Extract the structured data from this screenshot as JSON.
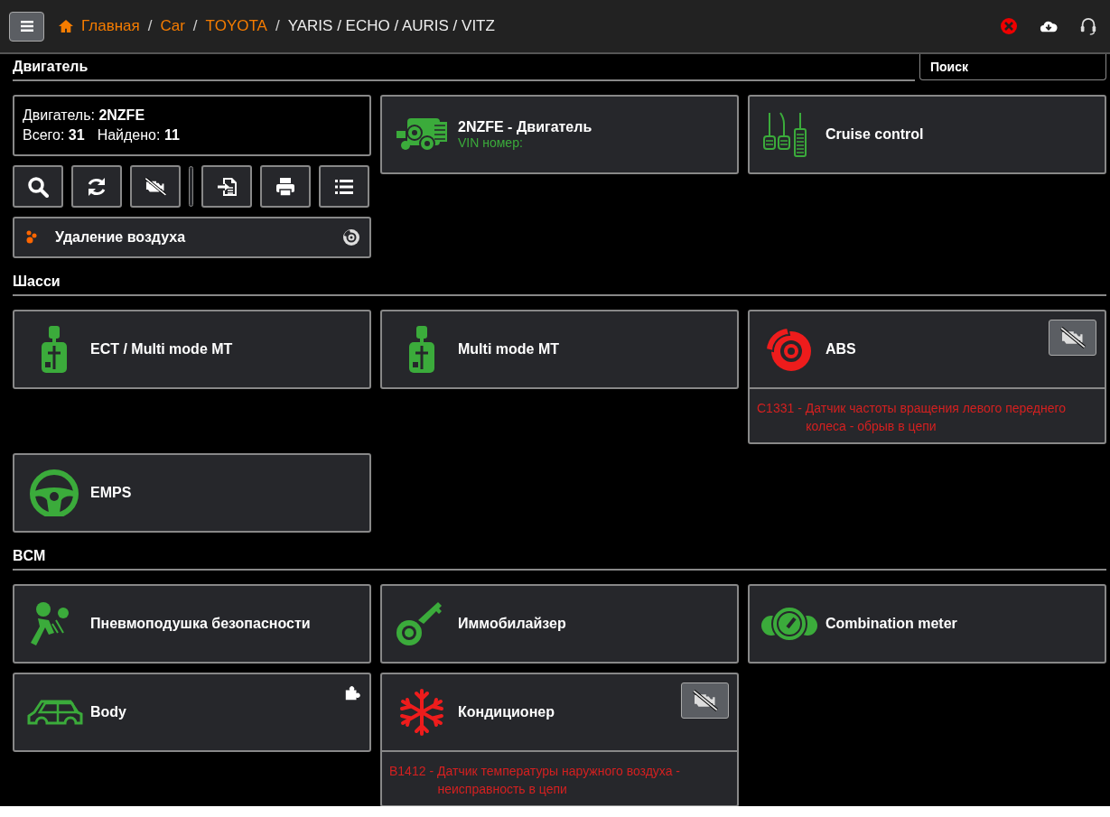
{
  "topbar": {
    "breadcrumbs": [
      {
        "label": "Главная",
        "link": true
      },
      {
        "label": "Car",
        "link": true
      },
      {
        "label": "TOYOTA",
        "link": true
      },
      {
        "label": "YARIS / ECHO / AURIS / VITZ",
        "link": false
      }
    ],
    "separators": [
      "/",
      "/",
      "/"
    ]
  },
  "search": {
    "placeholder": "Поиск"
  },
  "sections": [
    {
      "title": "Двигатель",
      "summary": {
        "lines": [
          [
            "Двигатель: **2NZFE**"
          ],
          [
            "Всего: **31**",
            "Найдено: **11**"
          ]
        ]
      },
      "toolbar": [
        {
          "kind": "search"
        },
        {
          "kind": "refresh"
        },
        {
          "kind": "engine-off"
        },
        {
          "kind": "separator"
        },
        {
          "kind": "import"
        },
        {
          "kind": "print"
        },
        {
          "kind": "list"
        }
      ],
      "procedure": {
        "label": "Удаление воздуха"
      },
      "modules": [
        {
          "name": "2NZFE - Двигатель",
          "subtitle": "VIN номер:",
          "kind": "engine",
          "fault": false
        },
        {
          "name": "Cruise control",
          "kind": "pedals",
          "fault": false
        }
      ]
    },
    {
      "title": "Шасси",
      "modules": [
        {
          "name": "ECT / Multi mode MT",
          "kind": "gearshift",
          "fault": false
        },
        {
          "name": "Multi mode MT",
          "kind": "gearshift",
          "fault": false
        },
        {
          "name": "ABS",
          "kind": "brake",
          "fault": true,
          "diagnostics_off": true,
          "dtc": {
            "code": "C1331",
            "description": "- Датчик частоты вращения левого переднего колеса - обрыв в цепи"
          }
        },
        {
          "name": "EMPS",
          "kind": "steering",
          "fault": false
        }
      ]
    },
    {
      "title": "BCM",
      "modules": [
        {
          "name": "Пневмоподушка безопасности",
          "kind": "airbag",
          "fault": false
        },
        {
          "name": "Иммобилайзер",
          "kind": "key",
          "fault": false
        },
        {
          "name": "Combination meter",
          "kind": "gauges",
          "fault": false
        },
        {
          "name": "Body",
          "kind": "car",
          "fault": false,
          "plugin": true
        },
        {
          "name": "Кондиционер",
          "kind": "snowflake",
          "fault": true,
          "diagnostics_off": true,
          "dtc": {
            "code": "B1412",
            "description": "- Датчик температуры наружного воздуха - неисправность в цепи"
          }
        }
      ]
    }
  ]
}
